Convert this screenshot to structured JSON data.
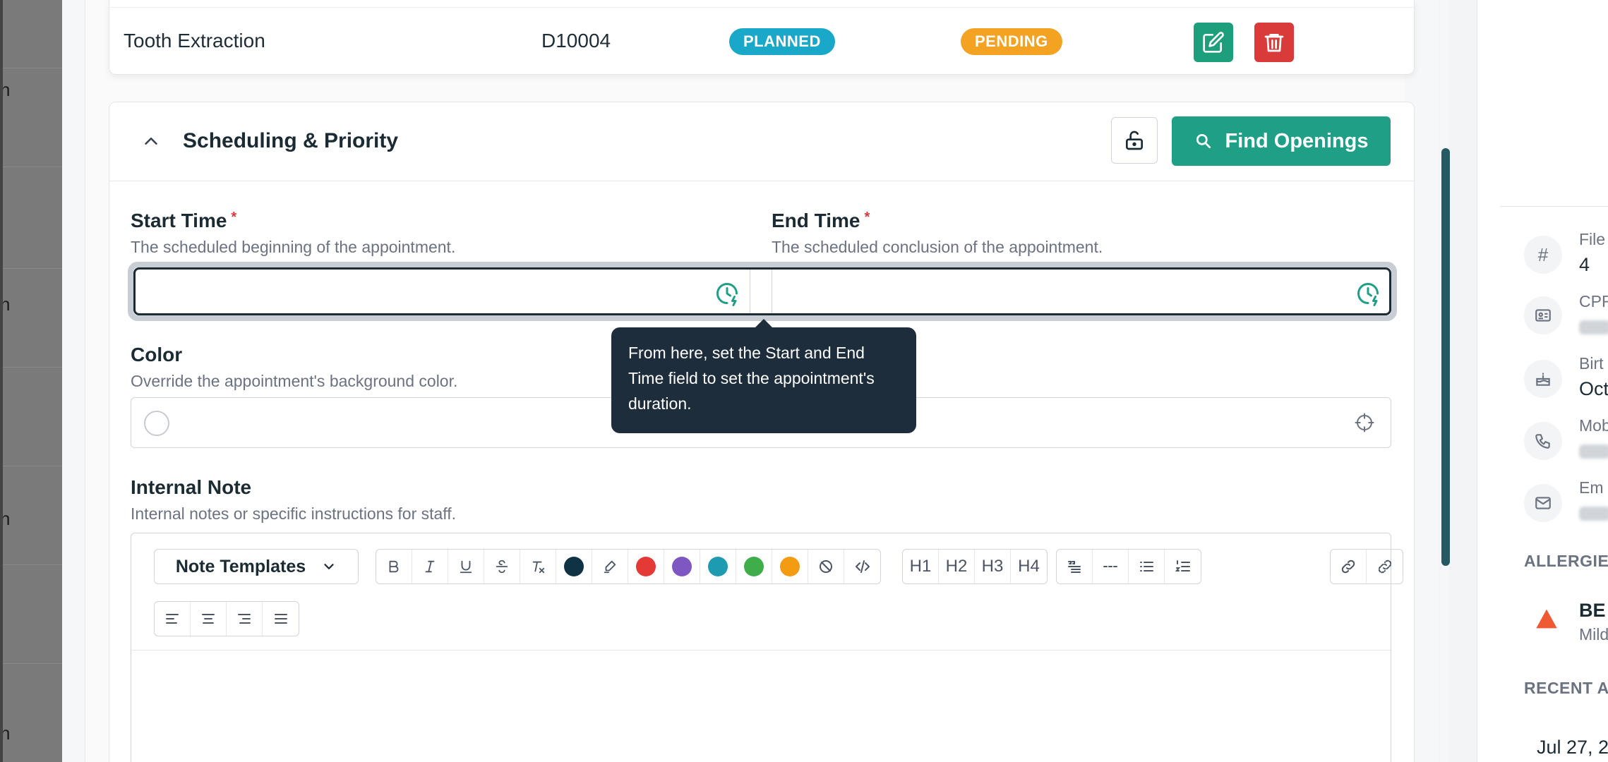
{
  "left_fragments": [
    "n",
    "n",
    "n",
    "n"
  ],
  "procedure_row": {
    "name": "Tooth Extraction",
    "code": "D10004",
    "status_badge": "PLANNED",
    "approval_badge": "PENDING"
  },
  "scheduling": {
    "title": "Scheduling & Priority",
    "find_openings_label": "Find Openings",
    "start_time": {
      "label": "Start Time",
      "required_mark": "*",
      "description": "The scheduled beginning of the appointment.",
      "value": ""
    },
    "end_time": {
      "label": "End Time",
      "required_mark": "*",
      "description": "The scheduled conclusion of the appointment.",
      "value": ""
    },
    "color": {
      "label": "Color",
      "description": "Override the appointment's background color."
    },
    "internal_note": {
      "label": "Internal Note",
      "description": "Internal notes or specific instructions for staff.",
      "templates_label": "Note Templates",
      "text_colors": [
        "#0f3344",
        "#e53935",
        "#7e57c2",
        "#1e9bb0",
        "#3fae4a",
        "#f39c12"
      ],
      "heading_buttons": [
        "H1",
        "H2",
        "H3",
        "H4"
      ]
    }
  },
  "tooltip": {
    "text": "From here, set the Start and End Time field to set the appointment's duration."
  },
  "patient_panel": {
    "file_label": "File",
    "file_value": "4",
    "cpr_label": "CPR",
    "birth_label": "Birt",
    "birth_value": "Oct",
    "mobile_label": "Mob",
    "email_label": "Em",
    "allergies_heading": "ALLERGIES",
    "allergy_name": "BE",
    "allergy_severity": "Mild",
    "recent_heading": "RECENT A",
    "recent_date": "Jul 27, 2"
  },
  "colors": {
    "primary": "#1e9f86",
    "danger": "#d93a3a",
    "planned": "#1aa8c9",
    "pending": "#f3a221",
    "tooltip_bg": "#1e2d3b"
  }
}
